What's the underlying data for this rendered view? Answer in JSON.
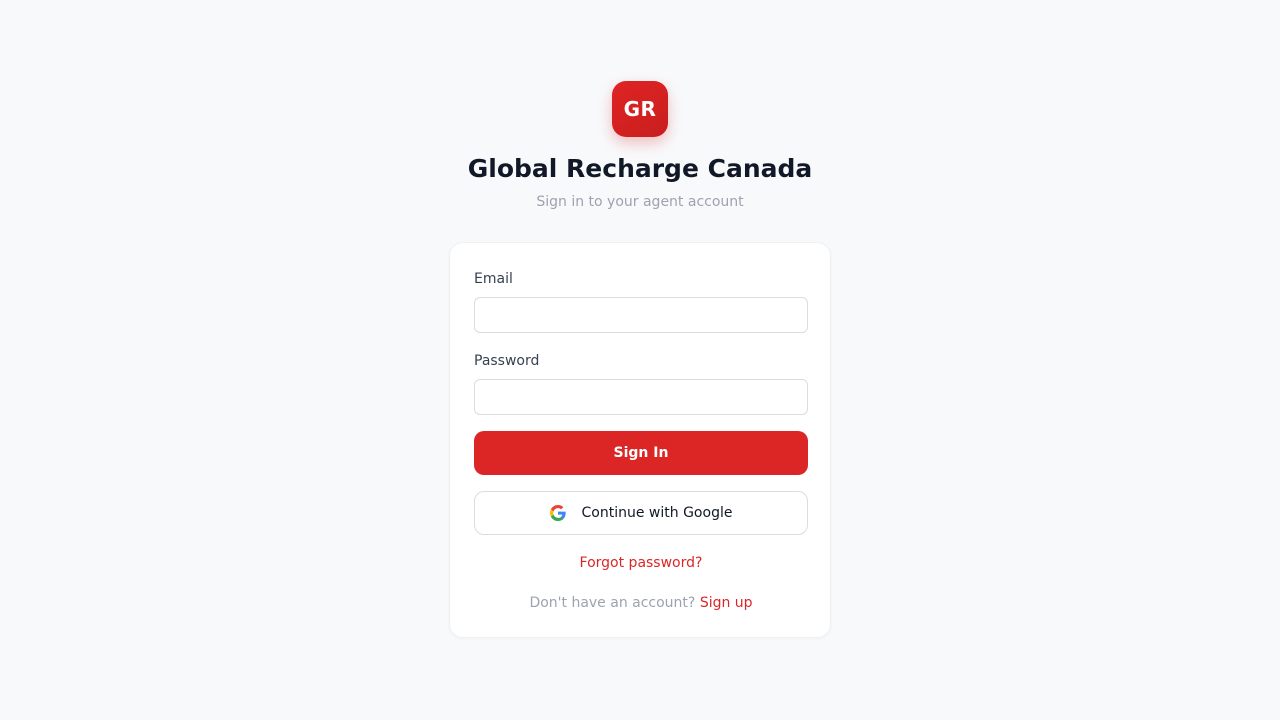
{
  "brand": {
    "logo_text": "GR",
    "title": "Global Recharge Canada",
    "subtitle": "Sign in to your agent account",
    "accent_color": "#dc2626"
  },
  "form": {
    "email_label": "Email",
    "email_value": "",
    "password_label": "Password",
    "password_value": "",
    "signin_label": "Sign In",
    "google_label": "Continue with Google",
    "google_icon": "google-icon",
    "forgot_label": "Forgot password?",
    "signup_prompt": "Don't have an account?",
    "signup_label": "Sign up"
  }
}
